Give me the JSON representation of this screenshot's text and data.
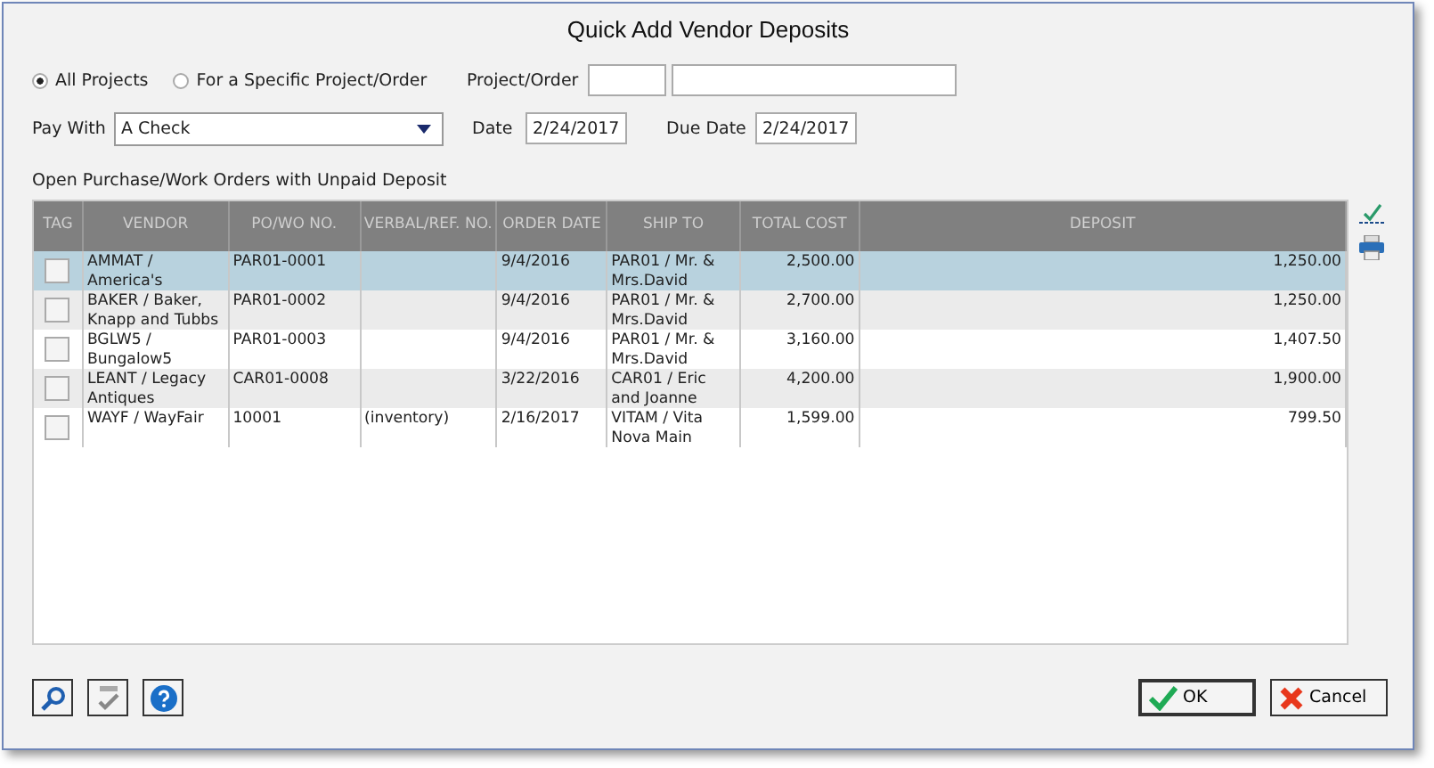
{
  "window": {
    "title": "Quick Add Vendor Deposits"
  },
  "scope": [
    {
      "label": "All Projects",
      "selected": true
    },
    {
      "label": "For a Specific Project/Order",
      "selected": false
    }
  ],
  "project_order": {
    "label": "Project/Order"
  },
  "pay_with": {
    "label": "Pay With",
    "value": "A Check"
  },
  "date": {
    "label": "Date",
    "value": "2/24/2017"
  },
  "due_date": {
    "label": "Due Date",
    "value": "2/24/2017"
  },
  "table": {
    "caption": "Open Purchase/Work Orders with Unpaid Deposit",
    "columns": [
      "TAG",
      "VENDOR",
      "PO/WO NO.",
      "VERBAL/REF. NO.",
      "ORDER DATE",
      "SHIP TO",
      "TOTAL COST",
      "DEPOSIT"
    ],
    "rows": [
      {
        "selected": true,
        "checked": false,
        "vendor": "AMMAT / America's",
        "po": "PAR01-0001",
        "ref": "",
        "order_date": "9/4/2016",
        "ship_to": "PAR01 / Mr. & Mrs.David",
        "total": "2,500.00",
        "deposit": "1,250.00"
      },
      {
        "selected": false,
        "checked": false,
        "vendor": "BAKER / Baker, Knapp and Tubbs",
        "po": "PAR01-0002",
        "ref": "",
        "order_date": "9/4/2016",
        "ship_to": "PAR01 / Mr. & Mrs.David",
        "total": "2,700.00",
        "deposit": "1,250.00"
      },
      {
        "selected": false,
        "checked": false,
        "vendor": "BGLW5 / Bungalow5",
        "po": "PAR01-0003",
        "ref": "",
        "order_date": "9/4/2016",
        "ship_to": "PAR01 / Mr. & Mrs.David",
        "total": "3,160.00",
        "deposit": "1,407.50"
      },
      {
        "selected": false,
        "checked": false,
        "vendor": "LEANT / Legacy Antiques",
        "po": "CAR01-0008",
        "ref": "",
        "order_date": "3/22/2016",
        "ship_to": "CAR01 / Eric and Joanne",
        "total": "4,200.00",
        "deposit": "1,900.00"
      },
      {
        "selected": false,
        "checked": false,
        "vendor": "WAYF / WayFair",
        "po": "10001",
        "ref": "(inventory)",
        "order_date": "2/16/2017",
        "ship_to": "VITAM / Vita Nova Main",
        "total": "1,599.00",
        "deposit": "799.50"
      }
    ]
  },
  "buttons": [
    {
      "label": "OK",
      "kind": "ok"
    },
    {
      "label": "Cancel",
      "kind": "cancel"
    }
  ]
}
